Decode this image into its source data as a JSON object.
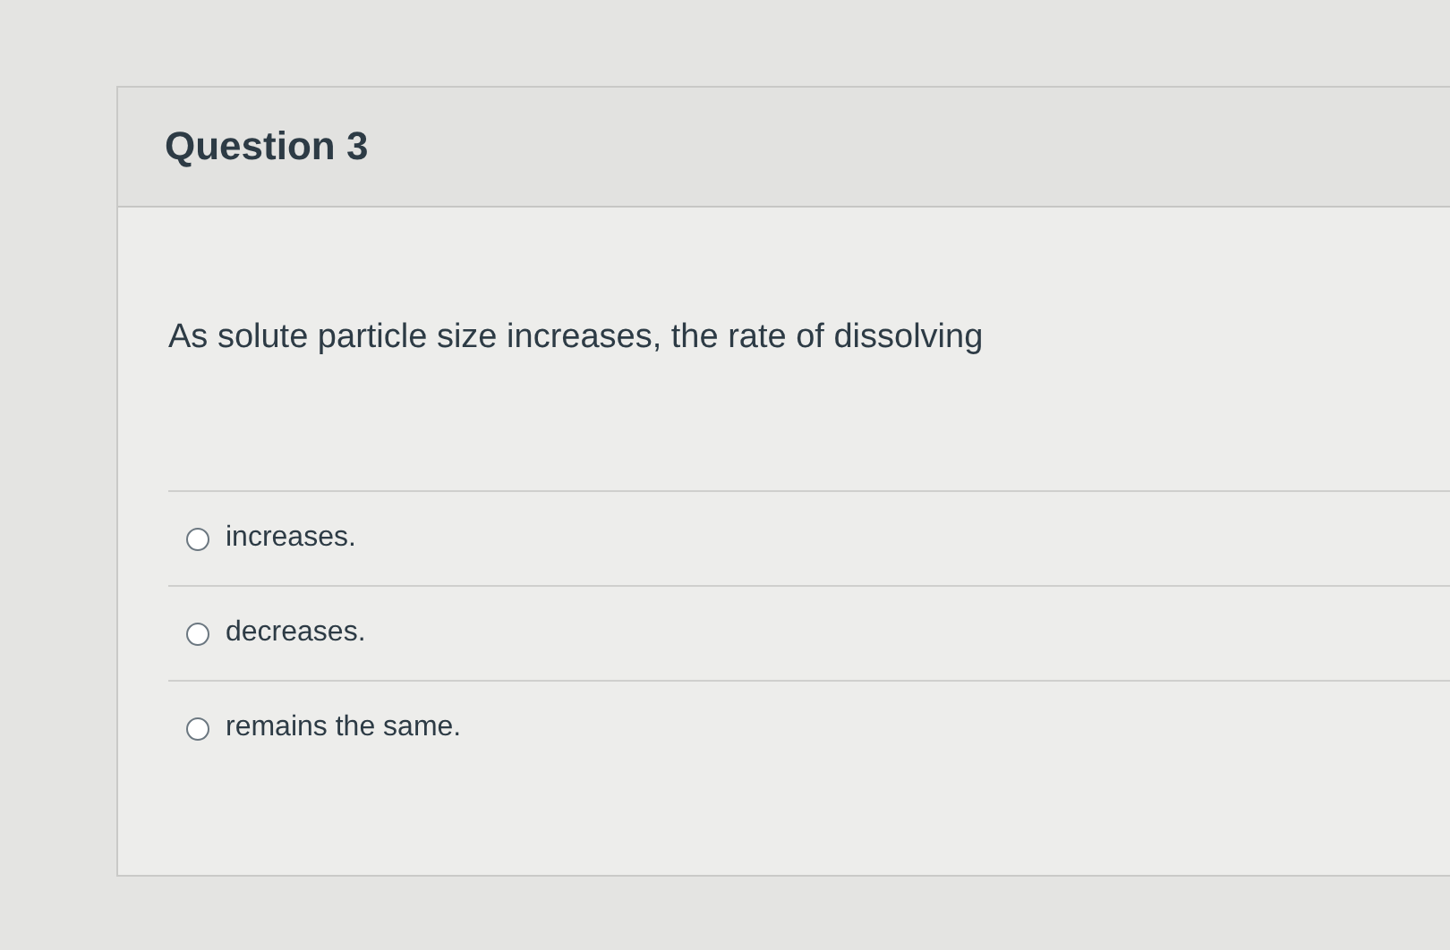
{
  "question": {
    "title": "Question 3",
    "prompt": "As solute particle size increases, the rate of dissolving"
  },
  "options": [
    {
      "label": "increases.",
      "selected": false
    },
    {
      "label": "decreases.",
      "selected": false
    },
    {
      "label": "remains the same.",
      "selected": false
    }
  ]
}
